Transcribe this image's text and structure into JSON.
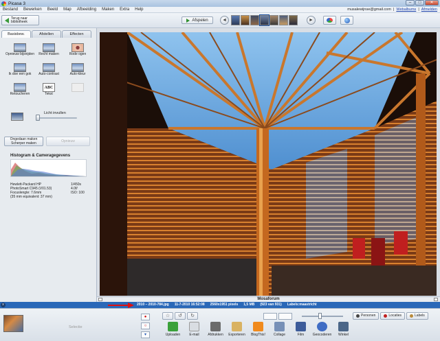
{
  "window": {
    "title": "Picasa 3",
    "buttons": [
      "–",
      "□",
      "✕"
    ]
  },
  "menu": {
    "items": [
      "Bestand",
      "Bewerken",
      "Beeld",
      "Map",
      "Afbeelding",
      "Maken",
      "Extra",
      "Help"
    ],
    "account_email": "musalewijnse@gmail.com",
    "web_albums": "Webalbums",
    "sign_out": "Afmelden"
  },
  "toolbar": {
    "back_label": "Terug naar bibliotheek",
    "play_label": "Afspelen",
    "prev": "◄",
    "next": "►"
  },
  "left_panel": {
    "tabs": [
      "Basisbew.",
      "Afstellen",
      "Effecten"
    ],
    "tools": [
      {
        "label": "Opnieuw bijsnijden",
        "icon": "crop-icon",
        "enabled": true
      },
      {
        "label": "Recht maken",
        "icon": "straighten-icon",
        "enabled": true
      },
      {
        "label": "Rode ogen",
        "icon": "red-eye-icon",
        "enabled": true
      },
      {
        "label": "Ik doe een gok",
        "icon": "feeling-lucky-icon",
        "enabled": true
      },
      {
        "label": "Auto-contrast",
        "icon": "auto-contrast-icon",
        "enabled": true
      },
      {
        "label": "Auto-kleur",
        "icon": "auto-color-icon",
        "enabled": true
      },
      {
        "label": "Retoucheren",
        "icon": "retouch-icon",
        "enabled": true
      },
      {
        "label": "Tekst",
        "icon": "text-icon",
        "enabled": true
      },
      {
        "label": "",
        "icon": "disabled-icon",
        "enabled": false
      }
    ],
    "text_icon_caption": "ABC",
    "fill_light_label": "Licht invullen",
    "undo_label": "Ongedaan maken Scherper maken",
    "redo_label": "Opnieuw",
    "histogram_title": "Histogram & Cameragegevens",
    "camera": [
      {
        "left": "Hewlett-Packard HP",
        "right": "1/450s"
      },
      {
        "left": "PhotoSmart C945 (V01.53)",
        "right": "4.0f/"
      },
      {
        "left": "Focuslengte: 7.6mm",
        "right": "ISO: 100"
      },
      {
        "left": "(35 mm equivalent: 37 mm)",
        "right": ""
      }
    ]
  },
  "viewer": {
    "caption": "Mosaforum"
  },
  "status": {
    "filename": "2010 – 2010-784.jpg",
    "date": "11-7-2010 16:52:08",
    "dimensions": "2560x1951 pixels",
    "size": "1,5 MB",
    "position": "(923 van 931)",
    "labels": "Labels:maastricht"
  },
  "bottom": {
    "selection_label": "Selectie",
    "people": "Personen",
    "location": "Locaties",
    "labels_btn": "Labels",
    "actions": [
      {
        "label": "Uploaden",
        "icon": "upload-icon",
        "color": "#3aa13a"
      },
      {
        "label": "E-mail",
        "icon": "email-icon",
        "color": "#d9dde2"
      },
      {
        "label": "Afdrukken",
        "icon": "print-icon",
        "color": "#6b6b6b"
      },
      {
        "label": "Exporteren",
        "icon": "export-icon",
        "color": "#d9b262"
      },
      {
        "label": "BlogThis!",
        "icon": "blogger-icon",
        "color": "#f08a1d"
      },
      {
        "label": "Collage",
        "icon": "collage-icon",
        "color": "#7790b7"
      },
      {
        "label": "Film",
        "icon": "film-icon",
        "color": "#3d5c9a"
      },
      {
        "label": "Geocoderen",
        "icon": "geotag-icon",
        "color": "#3f6cc4"
      },
      {
        "label": "Winkel",
        "icon": "shop-icon",
        "color": "#4b6688"
      }
    ]
  }
}
